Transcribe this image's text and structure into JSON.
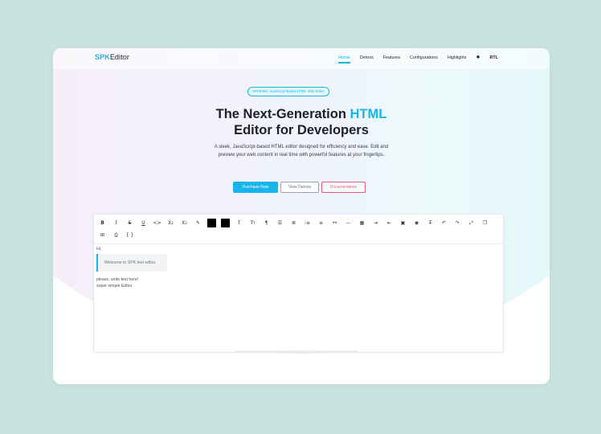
{
  "brand": {
    "prefix": "SPK",
    "suffix": "Editor"
  },
  "nav": {
    "items": [
      {
        "label": "Home",
        "active": true
      },
      {
        "label": "Demos"
      },
      {
        "label": "Features"
      },
      {
        "label": "Configurations"
      },
      {
        "label": "Highlights"
      }
    ],
    "theme_icon": "sun-icon",
    "rtl_label": "RTL"
  },
  "hero": {
    "badge": "SPKEditor JavaScript-Based HTML Web Editor",
    "title_part1": "The Next-Generation ",
    "title_highlight": "HTML",
    "title_part2": "Editor for Developers",
    "subtitle": "A sleek, JavaScript-based HTML editor designed for efficiency and ease. Edit and preview your web content in real time with powerful features at your fingertips.",
    "buttons": {
      "purchase": "Purchase Now",
      "demos": "View Demos",
      "docs": "Documentation"
    }
  },
  "editor": {
    "toolbar_icons": [
      "bold-icon",
      "italic-icon",
      "strikethrough-icon",
      "underline-icon",
      "code-icon",
      "subscript-icon",
      "superscript-icon",
      "highlighter-icon",
      "text-color-icon",
      "background-color-icon",
      "font-icon",
      "font-size-icon",
      "paragraph-icon",
      "bullet-list-icon",
      "align-icon",
      "ordered-list-icon",
      "numbered-list-icon",
      "link-icon",
      "horizontal-rule-icon",
      "table-icon",
      "indent-icon",
      "outdent-icon",
      "image-icon",
      "video-icon",
      "clear-format-icon",
      "undo-icon",
      "redo-icon",
      "fullscreen-icon",
      "copy-icon",
      "preview-icon",
      "print-icon",
      "source-code-icon"
    ],
    "content": {
      "line1": "Hi,",
      "quote": "Welcome to SPK text editor.",
      "line2": "please, write text here!",
      "line3": "super simple Editor"
    }
  },
  "colors": {
    "accent": "#16b6ec",
    "doc": "#e85a7a",
    "page_bg": "#c9e4df"
  }
}
